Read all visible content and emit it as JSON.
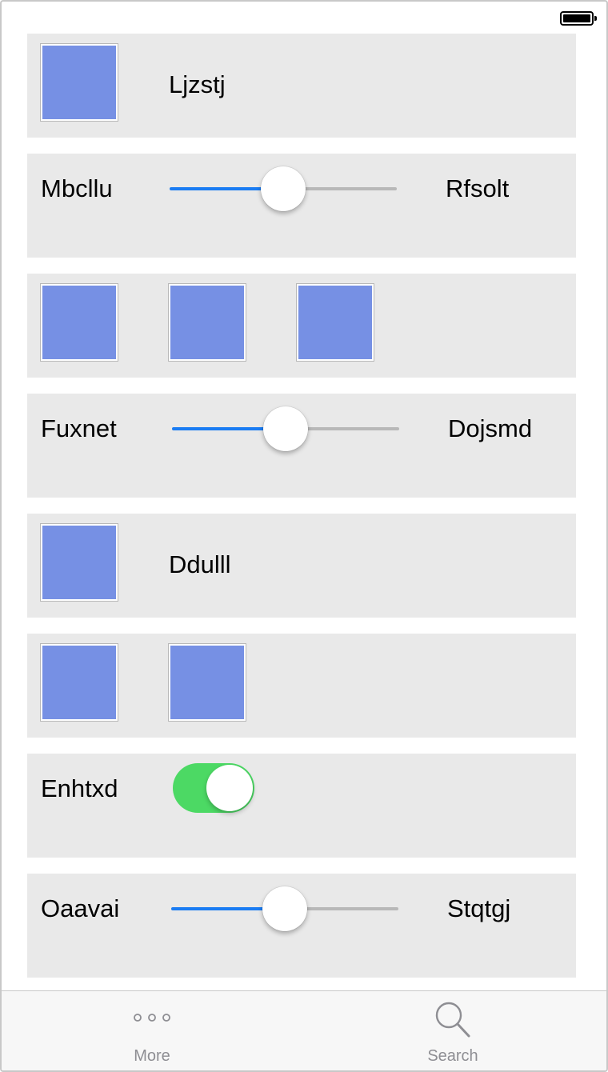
{
  "status_bar": {
    "battery_icon": "battery-full-icon"
  },
  "rows": [
    {
      "type": "image_label",
      "label": "Ljzstj"
    },
    {
      "type": "slider",
      "left_label": "Mbcllu",
      "right_label": "Rfsolt",
      "value": 0.5
    },
    {
      "type": "images",
      "count": 3
    },
    {
      "type": "slider",
      "left_label": "Fuxnet",
      "right_label": "Dojsmd",
      "value": 0.5
    },
    {
      "type": "image_label",
      "label": "Ddulll"
    },
    {
      "type": "images",
      "count": 2
    },
    {
      "type": "toggle",
      "label": "Enhtxd",
      "on": true
    },
    {
      "type": "slider",
      "left_label": "Oaavai",
      "right_label": "Stqtgj",
      "value": 0.5
    }
  ],
  "tab_bar": {
    "more": {
      "label": "More",
      "icon": "more-icon"
    },
    "search": {
      "label": "Search",
      "icon": "search-icon"
    }
  },
  "colors": {
    "row_background": "#e9e9e9",
    "image_fill": "#7690e4",
    "slider_active": "#1a7cf3",
    "toggle_on": "#4cd964",
    "tab_label": "#8e8e93"
  }
}
